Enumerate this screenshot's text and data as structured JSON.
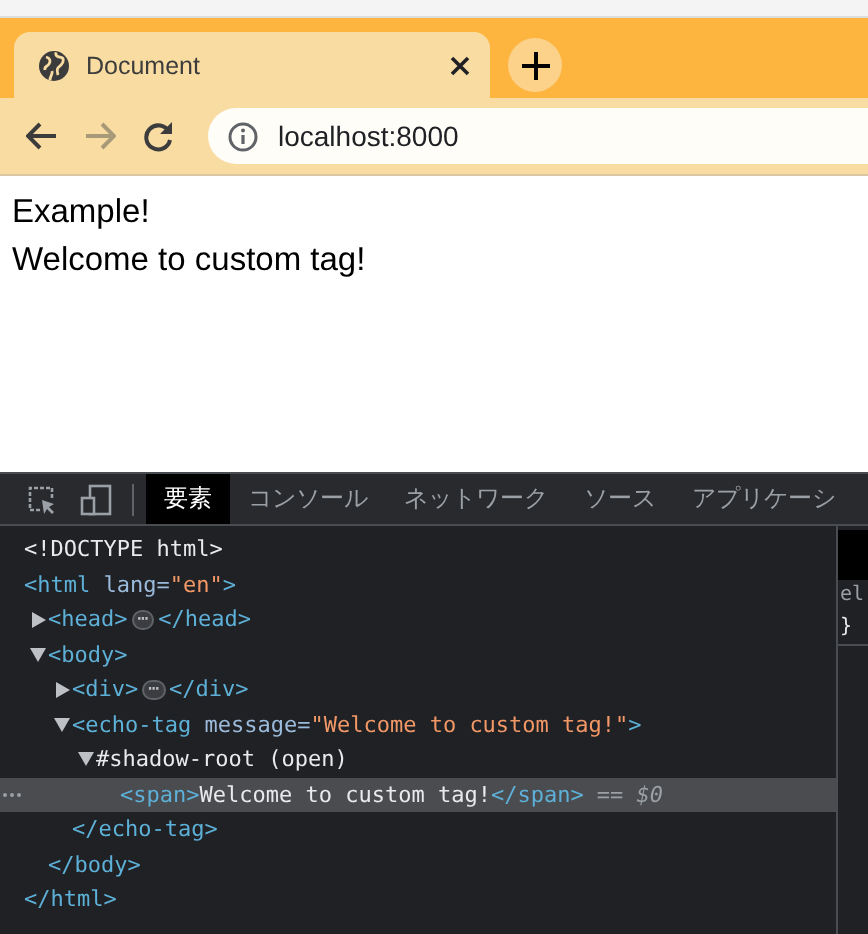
{
  "browser": {
    "tab": {
      "title": "Document"
    },
    "address_bar": {
      "value": "localhost:8000"
    },
    "nav": {
      "back_disabled": false,
      "forward_disabled": true
    }
  },
  "page": {
    "lines": [
      "Example!",
      "Welcome to custom tag!"
    ]
  },
  "devtools": {
    "tabs": [
      {
        "label": "要素",
        "selected": true
      },
      {
        "label": "コンソール",
        "selected": false
      },
      {
        "label": "ネットワーク",
        "selected": false
      },
      {
        "label": "ソース",
        "selected": false
      },
      {
        "label": "アプリケーシ",
        "selected": false
      }
    ],
    "tree": [
      {
        "selected": false,
        "tokens": [
          {
            "kind": "doctype",
            "text": "<!DOCTYPE html>"
          }
        ]
      },
      {
        "selected": false,
        "tokens": [
          {
            "kind": "tag",
            "text": "<html"
          },
          {
            "kind": "attr",
            "text": " lang="
          },
          {
            "kind": "value",
            "text": "\"en\""
          },
          {
            "kind": "tag",
            "text": ">"
          }
        ],
        "close": [
          {
            "kind": "tag",
            "text": "</html>"
          }
        ],
        "children": [
          {
            "selected": false,
            "expanded": false,
            "tokens": [
              {
                "kind": "tag",
                "text": "<head>"
              },
              {
                "kind": "ellipsis",
                "text": "⋯"
              },
              {
                "kind": "tag",
                "text": "</head>"
              }
            ]
          },
          {
            "selected": false,
            "expanded": true,
            "tokens": [
              {
                "kind": "tag",
                "text": "<body>"
              }
            ],
            "close": [
              {
                "kind": "tag",
                "text": "</body>"
              }
            ],
            "children": [
              {
                "selected": false,
                "expanded": false,
                "tokens": [
                  {
                    "kind": "tag",
                    "text": "<div>"
                  },
                  {
                    "kind": "ellipsis",
                    "text": "⋯"
                  },
                  {
                    "kind": "tag",
                    "text": "</div>"
                  }
                ]
              },
              {
                "selected": false,
                "expanded": true,
                "tokens": [
                  {
                    "kind": "tag",
                    "text": "<echo-tag"
                  },
                  {
                    "kind": "attr",
                    "text": " message="
                  },
                  {
                    "kind": "value",
                    "text": "\"Welcome to custom tag!\""
                  },
                  {
                    "kind": "tag",
                    "text": ">"
                  }
                ],
                "close": [
                  {
                    "kind": "tag",
                    "text": "</echo-tag>"
                  }
                ],
                "children": [
                  {
                    "selected": false,
                    "expanded": true,
                    "tokens": [
                      {
                        "kind": "text",
                        "text": "#shadow-root (open)"
                      }
                    ],
                    "children": [
                      {
                        "selected": true,
                        "tokens": [
                          {
                            "kind": "tag",
                            "text": "<span>"
                          },
                          {
                            "kind": "text",
                            "text": "Welcome to custom tag!"
                          },
                          {
                            "kind": "tag",
                            "text": "</span>"
                          },
                          {
                            "kind": "ref",
                            "text": " == $0"
                          }
                        ]
                      }
                    ]
                  }
                ]
              }
            ]
          }
        ]
      }
    ],
    "side_panel": {
      "lines": [
        "el",
        "}"
      ]
    }
  }
}
